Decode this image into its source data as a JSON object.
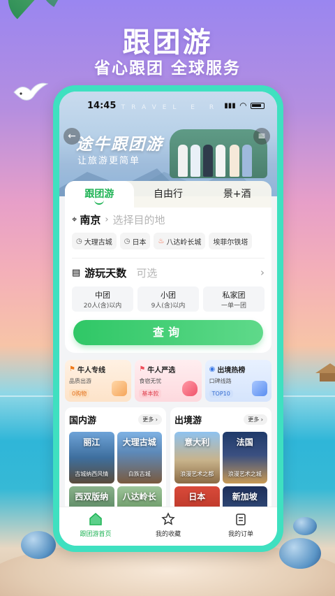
{
  "promo": {
    "title": "跟团游",
    "subtitle": "省心跟团 全球服务"
  },
  "status_bar": {
    "time": "14:45",
    "banner_watermark": "M    TRAVEL    E  R"
  },
  "banner": {
    "brand": "途牛跟团游",
    "slogan": "让旅游更简单"
  },
  "tabs": [
    {
      "label": "跟团游",
      "active": true
    },
    {
      "label": "自由行",
      "active": false
    },
    {
      "label": "景+酒",
      "active": false
    }
  ],
  "search_card": {
    "city": "南京",
    "destination_placeholder": "选择目的地",
    "chips": [
      {
        "label": "大理古城",
        "icon": "clock-icon"
      },
      {
        "label": "日本",
        "icon": "clock-icon"
      },
      {
        "label": "八达岭长城",
        "icon": "fire-icon"
      },
      {
        "label": "埃菲尔铁塔",
        "icon": "none"
      }
    ],
    "days_label": "游玩天数",
    "days_value": "可选",
    "group_types": [
      {
        "title": "中团",
        "sub": "20人(含)以内"
      },
      {
        "title": "小团",
        "sub": "9人(含)以内"
      },
      {
        "title": "私家团",
        "sub": "一单一团"
      }
    ],
    "search_button": "查询"
  },
  "features": [
    {
      "title": "牛人专线",
      "sub": "品质出游",
      "badge": "0购物",
      "accent": "#f07a1a"
    },
    {
      "title": "牛人严选",
      "sub": "食宿无忧",
      "badge": "基本款",
      "accent": "#ef4d5a"
    },
    {
      "title": "出境热榜",
      "sub": "口碑线路",
      "badge": "TOP10",
      "accent": "#3a78e6"
    }
  ],
  "domestic": {
    "title": "国内游",
    "more": "更多",
    "tiles": [
      {
        "name": "丽江",
        "sub": "古城纳西风情"
      },
      {
        "name": "大理古城",
        "sub": "白族古城"
      },
      {
        "name": "西双版纳",
        "sub": ""
      },
      {
        "name": "八达岭长",
        "sub": ""
      }
    ]
  },
  "outbound": {
    "title": "出境游",
    "more": "更多",
    "tiles": [
      {
        "name": "意大利",
        "sub": "浪漫艺术之都"
      },
      {
        "name": "法国",
        "sub": "浪漫艺术之城"
      },
      {
        "name": "日本",
        "sub": ""
      },
      {
        "name": "新加坡",
        "sub": ""
      }
    ]
  },
  "bottom_nav": [
    {
      "label": "跟团游首页",
      "icon": "home-icon",
      "active": true
    },
    {
      "label": "我的收藏",
      "icon": "star-icon",
      "active": false
    },
    {
      "label": "我的订单",
      "icon": "order-icon",
      "active": false
    }
  ],
  "colors": {
    "accent_green": "#1fb355",
    "phone_frame": "#3fe0c0"
  }
}
